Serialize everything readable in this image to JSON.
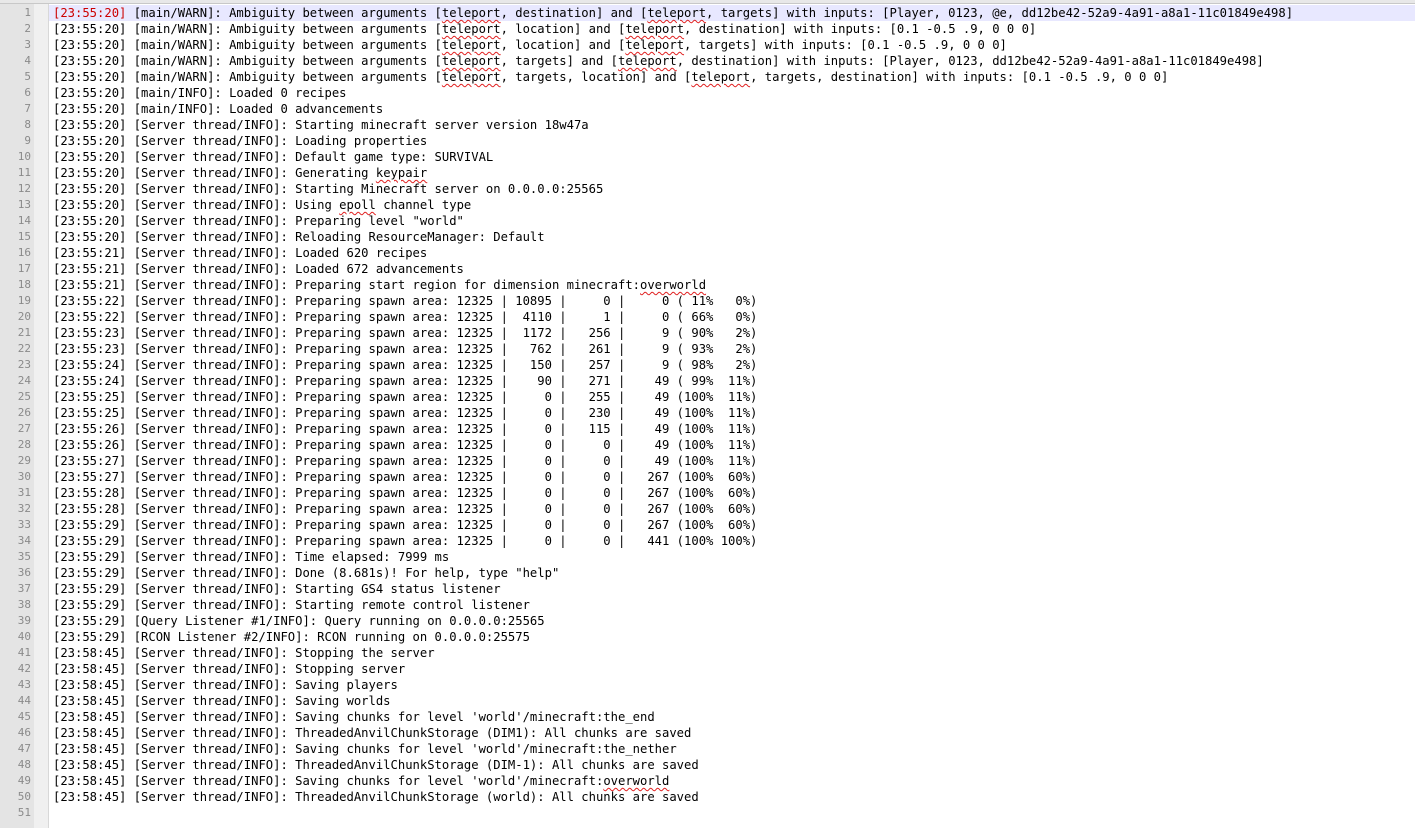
{
  "editor": {
    "current_line": 1,
    "colors": {
      "gutter_background": "#e4e4e4",
      "line_number_text": "#8a8a8a",
      "current_line_background": "#e8e8ff",
      "current_timestamp_text": "#cc0000",
      "spellcheck_underline": "#e02020"
    },
    "misspelled_words": [
      "teleport",
      "keypair",
      "epoll",
      "overworld"
    ],
    "lines": [
      {
        "number": "1",
        "text": "[23:55:20] [main/WARN]: Ambiguity between arguments [teleport, destination] and [teleport, targets] with inputs: [Player, 0123, @e, dd12be42-52a9-4a91-a8a1-11c01849e498]"
      },
      {
        "number": "2",
        "text": "[23:55:20] [main/WARN]: Ambiguity between arguments [teleport, location] and [teleport, destination] with inputs: [0.1 -0.5 .9, 0 0 0]"
      },
      {
        "number": "3",
        "text": "[23:55:20] [main/WARN]: Ambiguity between arguments [teleport, location] and [teleport, targets] with inputs: [0.1 -0.5 .9, 0 0 0]"
      },
      {
        "number": "4",
        "text": "[23:55:20] [main/WARN]: Ambiguity between arguments [teleport, targets] and [teleport, destination] with inputs: [Player, 0123, dd12be42-52a9-4a91-a8a1-11c01849e498]"
      },
      {
        "number": "5",
        "text": "[23:55:20] [main/WARN]: Ambiguity between arguments [teleport, targets, location] and [teleport, targets, destination] with inputs: [0.1 -0.5 .9, 0 0 0]"
      },
      {
        "number": "6",
        "text": "[23:55:20] [main/INFO]: Loaded 0 recipes"
      },
      {
        "number": "7",
        "text": "[23:55:20] [main/INFO]: Loaded 0 advancements"
      },
      {
        "number": "8",
        "text": "[23:55:20] [Server thread/INFO]: Starting minecraft server version 18w47a"
      },
      {
        "number": "9",
        "text": "[23:55:20] [Server thread/INFO]: Loading properties"
      },
      {
        "number": "10",
        "text": "[23:55:20] [Server thread/INFO]: Default game type: SURVIVAL"
      },
      {
        "number": "11",
        "text": "[23:55:20] [Server thread/INFO]: Generating keypair"
      },
      {
        "number": "12",
        "text": "[23:55:20] [Server thread/INFO]: Starting Minecraft server on 0.0.0.0:25565"
      },
      {
        "number": "13",
        "text": "[23:55:20] [Server thread/INFO]: Using epoll channel type"
      },
      {
        "number": "14",
        "text": "[23:55:20] [Server thread/INFO]: Preparing level \"world\""
      },
      {
        "number": "15",
        "text": "[23:55:20] [Server thread/INFO]: Reloading ResourceManager: Default"
      },
      {
        "number": "16",
        "text": "[23:55:21] [Server thread/INFO]: Loaded 620 recipes"
      },
      {
        "number": "17",
        "text": "[23:55:21] [Server thread/INFO]: Loaded 672 advancements"
      },
      {
        "number": "18",
        "text": "[23:55:21] [Server thread/INFO]: Preparing start region for dimension minecraft:overworld"
      },
      {
        "number": "19",
        "text": "[23:55:22] [Server thread/INFO]: Preparing spawn area: 12325 | 10895 |     0 |     0 ( 11%   0%)"
      },
      {
        "number": "20",
        "text": "[23:55:22] [Server thread/INFO]: Preparing spawn area: 12325 |  4110 |     1 |     0 ( 66%   0%)"
      },
      {
        "number": "21",
        "text": "[23:55:23] [Server thread/INFO]: Preparing spawn area: 12325 |  1172 |   256 |     9 ( 90%   2%)"
      },
      {
        "number": "22",
        "text": "[23:55:23] [Server thread/INFO]: Preparing spawn area: 12325 |   762 |   261 |     9 ( 93%   2%)"
      },
      {
        "number": "23",
        "text": "[23:55:24] [Server thread/INFO]: Preparing spawn area: 12325 |   150 |   257 |     9 ( 98%   2%)"
      },
      {
        "number": "24",
        "text": "[23:55:24] [Server thread/INFO]: Preparing spawn area: 12325 |    90 |   271 |    49 ( 99%  11%)"
      },
      {
        "number": "25",
        "text": "[23:55:25] [Server thread/INFO]: Preparing spawn area: 12325 |     0 |   255 |    49 (100%  11%)"
      },
      {
        "number": "26",
        "text": "[23:55:25] [Server thread/INFO]: Preparing spawn area: 12325 |     0 |   230 |    49 (100%  11%)"
      },
      {
        "number": "27",
        "text": "[23:55:26] [Server thread/INFO]: Preparing spawn area: 12325 |     0 |   115 |    49 (100%  11%)"
      },
      {
        "number": "28",
        "text": "[23:55:26] [Server thread/INFO]: Preparing spawn area: 12325 |     0 |     0 |    49 (100%  11%)"
      },
      {
        "number": "29",
        "text": "[23:55:27] [Server thread/INFO]: Preparing spawn area: 12325 |     0 |     0 |    49 (100%  11%)"
      },
      {
        "number": "30",
        "text": "[23:55:27] [Server thread/INFO]: Preparing spawn area: 12325 |     0 |     0 |   267 (100%  60%)"
      },
      {
        "number": "31",
        "text": "[23:55:28] [Server thread/INFO]: Preparing spawn area: 12325 |     0 |     0 |   267 (100%  60%)"
      },
      {
        "number": "32",
        "text": "[23:55:28] [Server thread/INFO]: Preparing spawn area: 12325 |     0 |     0 |   267 (100%  60%)"
      },
      {
        "number": "33",
        "text": "[23:55:29] [Server thread/INFO]: Preparing spawn area: 12325 |     0 |     0 |   267 (100%  60%)"
      },
      {
        "number": "34",
        "text": "[23:55:29] [Server thread/INFO]: Preparing spawn area: 12325 |     0 |     0 |   441 (100% 100%)"
      },
      {
        "number": "35",
        "text": "[23:55:29] [Server thread/INFO]: Time elapsed: 7999 ms"
      },
      {
        "number": "36",
        "text": "[23:55:29] [Server thread/INFO]: Done (8.681s)! For help, type \"help\""
      },
      {
        "number": "37",
        "text": "[23:55:29] [Server thread/INFO]: Starting GS4 status listener"
      },
      {
        "number": "38",
        "text": "[23:55:29] [Server thread/INFO]: Starting remote control listener"
      },
      {
        "number": "39",
        "text": "[23:55:29] [Query Listener #1/INFO]: Query running on 0.0.0.0:25565"
      },
      {
        "number": "40",
        "text": "[23:55:29] [RCON Listener #2/INFO]: RCON running on 0.0.0.0:25575"
      },
      {
        "number": "41",
        "text": "[23:58:45] [Server thread/INFO]: Stopping the server"
      },
      {
        "number": "42",
        "text": "[23:58:45] [Server thread/INFO]: Stopping server"
      },
      {
        "number": "43",
        "text": "[23:58:45] [Server thread/INFO]: Saving players"
      },
      {
        "number": "44",
        "text": "[23:58:45] [Server thread/INFO]: Saving worlds"
      },
      {
        "number": "45",
        "text": "[23:58:45] [Server thread/INFO]: Saving chunks for level 'world'/minecraft:the_end"
      },
      {
        "number": "46",
        "text": "[23:58:45] [Server thread/INFO]: ThreadedAnvilChunkStorage (DIM1): All chunks are saved"
      },
      {
        "number": "47",
        "text": "[23:58:45] [Server thread/INFO]: Saving chunks for level 'world'/minecraft:the_nether"
      },
      {
        "number": "48",
        "text": "[23:58:45] [Server thread/INFO]: ThreadedAnvilChunkStorage (DIM-1): All chunks are saved"
      },
      {
        "number": "49",
        "text": "[23:58:45] [Server thread/INFO]: Saving chunks for level 'world'/minecraft:overworld"
      },
      {
        "number": "50",
        "text": "[23:58:45] [Server thread/INFO]: ThreadedAnvilChunkStorage (world): All chunks are saved"
      },
      {
        "number": "51",
        "text": ""
      }
    ]
  }
}
